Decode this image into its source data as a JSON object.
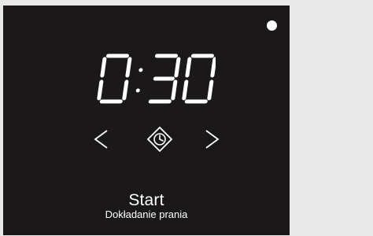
{
  "display": {
    "time": "0:30",
    "status_indicator": "white-dot"
  },
  "navigation": {
    "prev_icon": "chevron-left-icon",
    "center_icon": "timer-diamond-icon",
    "next_icon": "chevron-right-icon"
  },
  "labels": {
    "primary": "Start",
    "secondary": "Dokładanie prania"
  },
  "colors": {
    "display_background": "#1a1818",
    "foreground": "#ffffff",
    "page_background": "#e8e8e8"
  }
}
